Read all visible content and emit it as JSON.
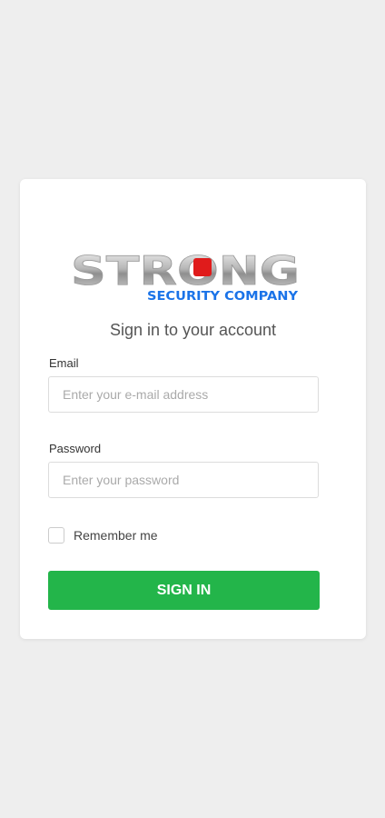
{
  "brand": {
    "logo_main": "STRONG",
    "logo_sub": "SECURITY COMPANY",
    "logo_accent_color": "#e01b1b",
    "logo_sub_color": "#1a73e8"
  },
  "form": {
    "heading": "Sign in to your account",
    "email_label": "Email",
    "email_placeholder": "Enter your e-mail address",
    "email_value": "",
    "password_label": "Password",
    "password_placeholder": "Enter your password",
    "password_value": "",
    "remember_label": "Remember me",
    "remember_checked": false,
    "submit_label": "SIGN IN",
    "submit_color": "#23b54a"
  }
}
